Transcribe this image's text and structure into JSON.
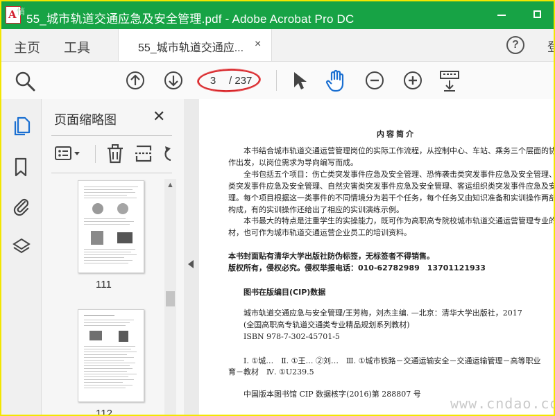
{
  "window": {
    "title": "55_城市轨道交通应急及安全管理.pdf - Adobe Acrobat Pro DC",
    "brand_color": "#17a345"
  },
  "app_icon": {
    "watermark_glyph": "悄"
  },
  "tabs": {
    "home": "主页",
    "tools": "工具",
    "document_tab": "55_城市轨道交通应...",
    "close_glyph": "×",
    "right_fragment": "登"
  },
  "help": "?",
  "toolbar": {
    "current_page": "3",
    "total_pages": "/ 237",
    "highlight_color": "#d7262a"
  },
  "rail": {
    "icons": [
      "page-thumbnails-icon",
      "bookmark-icon",
      "attachment-icon",
      "layers-icon"
    ]
  },
  "thumbnails": {
    "title": "页面缩略图",
    "close": "✕",
    "pages": [
      {
        "number": "111"
      },
      {
        "number": "112"
      }
    ]
  },
  "document": {
    "heading": "内容简介",
    "lines": [
      "本书结合城市轨道交通运营管理岗位的实际工作流程，从控制中心、车站、乘务三个层面的协调",
      "作出发，以岗位需求为导向编写而成。",
      "全书包括五个项目：伤亡类突发事件应急及安全管理、恐怖袭击类突发事件应急及安全管理、火",
      "类突发事件应急及安全管理、自然灾害类突发事件应急及安全管理、客运组织类突发事件应急及安",
      "理。每个项目根据这一类事件的不同情境分为若干个任务，每个任务又由知识准备和实训操作两部",
      "构成，有的实训操作还给出了相应的实训演练示例。",
      "本书最大的特点是注重学生的实操能力，既可作为高职高专院校城市轨道交通运营管理专业的",
      "材，也可作为城市轨道交通运营企业员工的培训资料。"
    ],
    "notice1": "本书封面贴有清华大学出版社防伪标签，无标签者不得销售。",
    "notice2": "版权所有，侵权必究。侵权举报电话：010-62782989　13701121933",
    "cip_title": "图书在版编目(CIP)数据",
    "cip_lines": [
      "城市轨道交通应急与安全管理/王芳梅，刘杰主编. —北京：清华大学出版社，2017",
      "(全国高职高专轨道交通类专业精品规划系列教材)",
      "ISBN 978-7-302-45701-5"
    ],
    "class_line1": "Ⅰ. ①城…　Ⅱ. ①王…  ②刘…　Ⅲ. ①城市铁路－交通运输安全－交通运输管理－高等职业",
    "class_line2": "育－教材　Ⅳ. ①U239.5",
    "cip_number": "中国版本图书馆 CIP 数据核字(2016)第 288807 号",
    "watermark": "www.cndao.com"
  }
}
